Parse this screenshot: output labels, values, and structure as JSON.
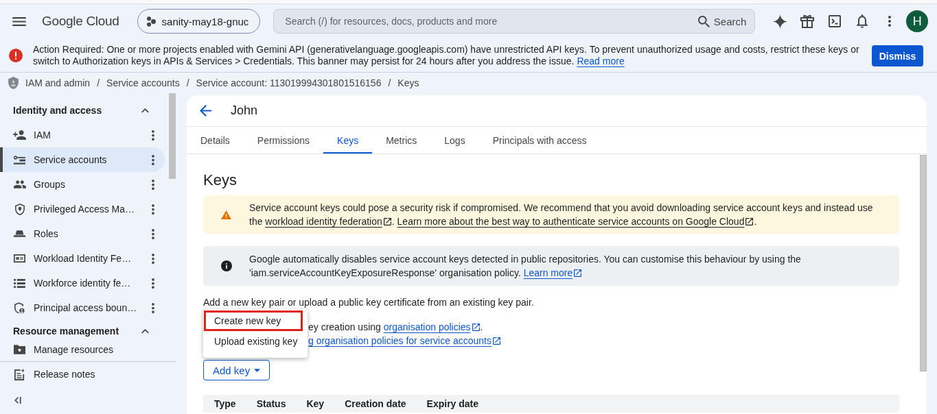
{
  "header": {
    "logo": "Google Cloud",
    "project": "sanity-may18-gnuc",
    "search": {
      "placeholder": "Search (/) for resources, docs, products and more",
      "button": "Search"
    },
    "avatar": "H"
  },
  "banner": {
    "text": "Action Required: One or more projects enabled with Gemini API (generativelanguage.googleapis.com) have unrestricted API keys. To prevent unauthorized usage and costs, restrict these keys or switch to Authorization keys in APIs & Services > Credentials. This banner may persist for 24 hours after you address the issue.",
    "link": "Read more",
    "button": "Dismiss"
  },
  "breadcrumb": [
    {
      "text": "IAM and admin",
      "separator": "/"
    },
    {
      "text": "Service accounts",
      "separator": "/"
    },
    {
      "text": "Service account: 113019994301801516156",
      "separator": "/"
    },
    {
      "text": "Keys"
    }
  ],
  "sidebar": {
    "sections": [
      {
        "title": "Identity and access",
        "expanded": true,
        "items": [
          {
            "label": "IAM",
            "selected": false,
            "more": true
          },
          {
            "label": "Service accounts",
            "selected": true,
            "more": true
          },
          {
            "label": "Groups",
            "selected": false,
            "more": true
          },
          {
            "label": "Privileged Access Ma…",
            "selected": false,
            "more": true
          },
          {
            "label": "Roles",
            "selected": false,
            "more": true
          },
          {
            "label": "Workload Identity Fe…",
            "selected": false,
            "more": true
          },
          {
            "label": "Workforce identity fe…",
            "selected": false,
            "more": true
          },
          {
            "label": "Principal access boun…",
            "selected": false,
            "more": true
          }
        ]
      },
      {
        "title": "Resource management",
        "expanded": true,
        "items": [
          {
            "label": "Manage resources",
            "selected": false,
            "more": false
          }
        ]
      }
    ],
    "footer": [
      {
        "label": "Release notes"
      }
    ]
  },
  "page": {
    "title": "John",
    "tabs": [
      {
        "label": "Details",
        "selected": false
      },
      {
        "label": "Permissions",
        "selected": false
      },
      {
        "label": "Keys",
        "selected": true
      },
      {
        "label": "Metrics",
        "selected": false
      },
      {
        "label": "Logs",
        "selected": false
      },
      {
        "label": "Principals with access",
        "selected": false
      }
    ],
    "heading": "Keys",
    "alerts": [
      {
        "kind": "warning",
        "parts": [
          {
            "kind": "text",
            "text": "Service account keys could pose a security risk if compromised. We recommend that you avoid downloading service account keys and instead use the "
          },
          {
            "kind": "link",
            "text": "workload identity federation",
            "external": true
          },
          {
            "kind": "text",
            "text": ". "
          },
          {
            "kind": "link",
            "text": "Learn more about the best way to authenticate service accounts on Google Cloud",
            "external": true
          },
          {
            "kind": "text",
            "text": "."
          }
        ]
      },
      {
        "kind": "info",
        "parts": [
          {
            "kind": "text",
            "text": "Google automatically disables service account keys detected in public repositories. You can customise this behaviour by using the 'iam.serviceAccountKeyExposureResponse' organisation policy. "
          },
          {
            "kind": "link",
            "text": "Learn more",
            "external": true
          }
        ]
      }
    ],
    "intro": "Add a new key pair or upload a public key certificate from an existing key pair.",
    "lines": [
      {
        "parts": [
          {
            "kind": "text",
            "text": "ey creation using "
          },
          {
            "kind": "link",
            "text": "organisation policies",
            "external": true
          },
          {
            "kind": "text",
            "text": "."
          }
        ]
      },
      {
        "parts": [
          {
            "kind": "link",
            "text": "g organisation policies for service accounts",
            "external": true
          }
        ]
      }
    ],
    "add_button": "Add key",
    "menu": [
      {
        "label": "Create new key",
        "highlighted": true
      },
      {
        "label": "Upload existing key",
        "highlighted": false
      }
    ],
    "table": {
      "columns": [
        "Type",
        "Status",
        "Key",
        "Creation date",
        "Expiry date"
      ]
    }
  }
}
